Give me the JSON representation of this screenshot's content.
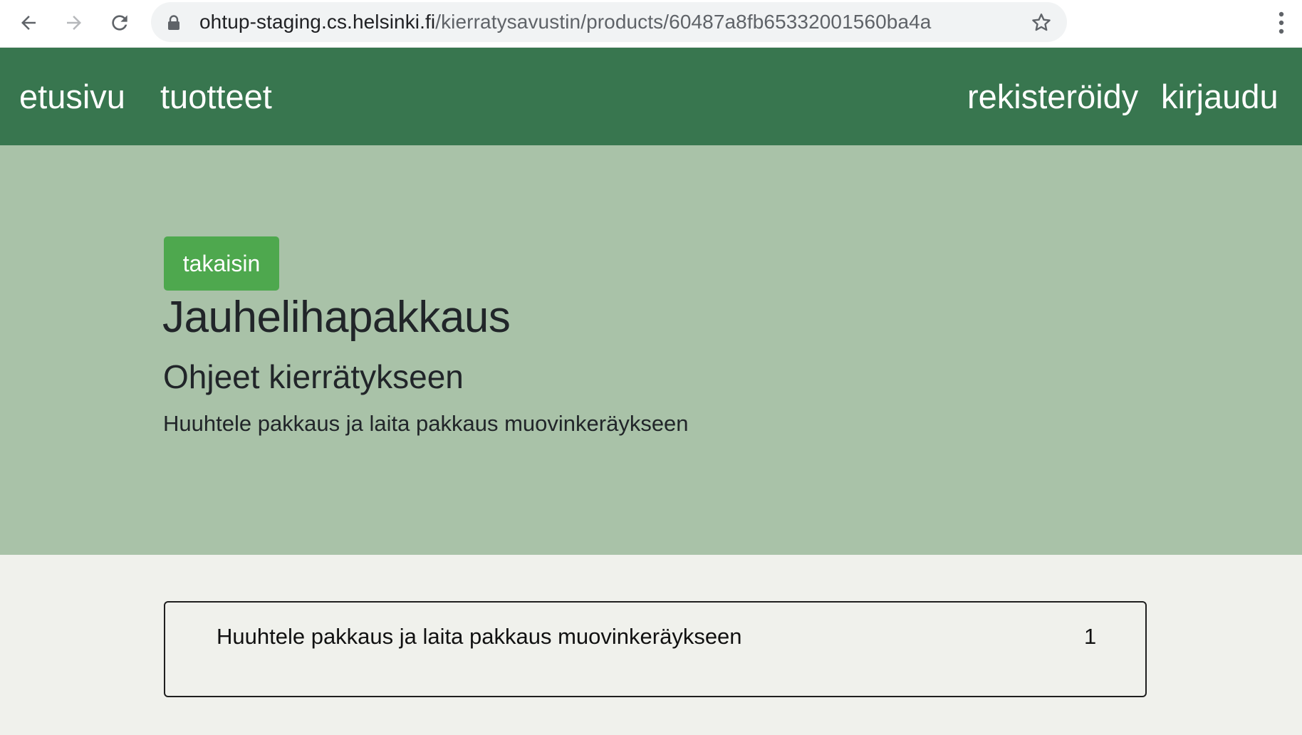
{
  "browser": {
    "url_host": "ohtup-staging.cs.helsinki.fi",
    "url_path": "/kierratysavustin/products/60487a8fb65332001560ba4a",
    "icons": {
      "back": "arrow-left-icon",
      "forward": "arrow-right-icon",
      "reload": "reload-icon",
      "lock": "lock-icon",
      "bookmark": "star-icon",
      "menu": "kebab-menu-icon"
    }
  },
  "navbar": {
    "home_label": "etusivu",
    "products_label": "tuotteet",
    "register_label": "rekisteröidy",
    "login_label": "kirjaudu"
  },
  "product": {
    "back_label": "takaisin",
    "title": "Jauhelihapakkaus",
    "instructions_heading": "Ohjeet kierrätykseen",
    "instruction": "Huuhtele pakkaus ja laita pakkaus muovinkeräykseen"
  },
  "instruction_card": {
    "text": "Huuhtele pakkaus ja laita pakkaus muovinkeräykseen",
    "count": "1"
  },
  "colors": {
    "navbar": "#38764f",
    "hero": "#a9c2a8",
    "button": "#4ea84e",
    "page_background": "#f0f1ec"
  }
}
